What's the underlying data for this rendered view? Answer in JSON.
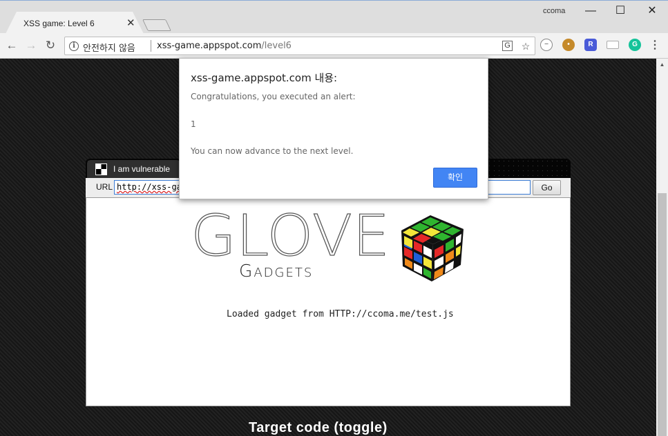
{
  "browser": {
    "tab_title": "XSS game: Level 6",
    "profile_name": "ccoma",
    "security_label": "안전하지 않음",
    "url_host": "xss-game.appspot.com",
    "url_path": "/level6",
    "extensions": [
      {
        "name": "block-icon",
        "color": "#888888"
      },
      {
        "name": "cookie-icon",
        "color": "#c58a2b"
      },
      {
        "name": "r-shield-icon",
        "color": "#4a5bd8",
        "label": "R"
      },
      {
        "name": "cast-icon",
        "color": "#999999"
      },
      {
        "name": "grammarly-icon",
        "color": "#15c39a",
        "label": "G"
      }
    ]
  },
  "frame": {
    "tab_label": "I am vulnerable",
    "url_label": "URL",
    "url_value": "http://xss-gam",
    "go_label": "Go"
  },
  "content": {
    "logo_text": "GLOVE",
    "gadgets_text": "Gadgets",
    "loaded_text": "Loaded gadget from HTTP://ccoma.me/test.js",
    "target_code": "Target code (toggle)"
  },
  "dialog": {
    "title": "xss-game.appspot.com 내용:",
    "line1": "Congratulations, you executed an alert:",
    "line2": "1",
    "line3": "You can now advance to the next level.",
    "ok_label": "확인"
  },
  "colors": {
    "accent": "#4285f4",
    "page_background": "#1a1a1a"
  }
}
